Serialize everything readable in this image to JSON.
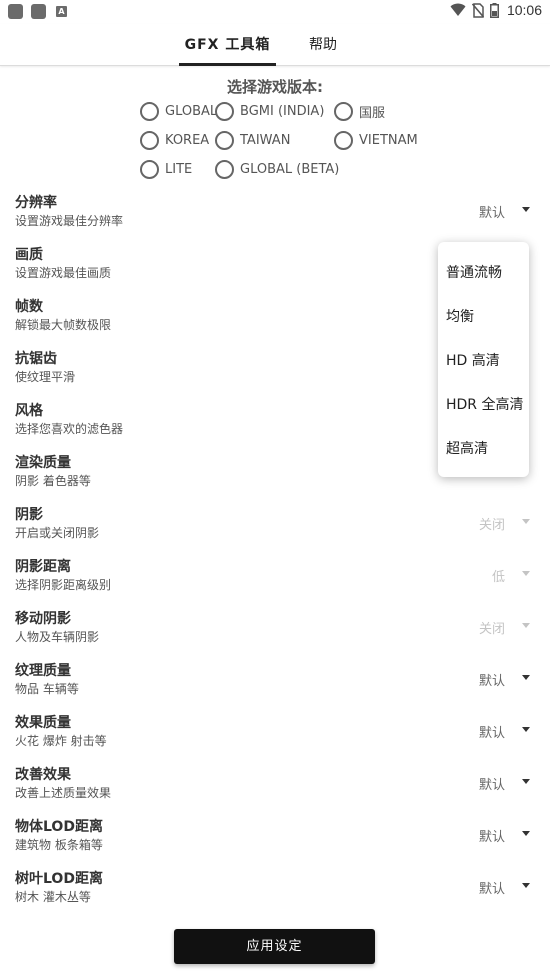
{
  "status_bar": {
    "time": "10:06",
    "left_icons": [
      "app-icon",
      "app-icon",
      "notification-a-icon"
    ],
    "right_icons": [
      "wifi-icon",
      "no-sim-icon",
      "battery-icon"
    ],
    "small_icon_letter": "A"
  },
  "tabs": [
    {
      "label": "GFX 工具箱",
      "active": true
    },
    {
      "label": "帮助",
      "active": false
    }
  ],
  "version": {
    "title": "选择游戏版本:",
    "options": [
      "GLOBAL",
      "BGMI (INDIA)",
      "国服",
      "KOREA",
      "TAIWAN",
      "VIETNAM",
      "LITE",
      "GLOBAL (BETA)"
    ]
  },
  "settings": [
    {
      "title": "分辨率",
      "subtitle": "设置游戏最佳分辨率",
      "value": "默认",
      "faded": false
    },
    {
      "title": "画质",
      "subtitle": "设置游戏最佳画质",
      "value": "",
      "faded": false
    },
    {
      "title": "帧数",
      "subtitle": "解锁最大帧数极限",
      "value": "",
      "faded": false
    },
    {
      "title": "抗锯齿",
      "subtitle": "使纹理平滑",
      "value": "",
      "faded": false
    },
    {
      "title": "风格",
      "subtitle": "选择您喜欢的滤色器",
      "value": "",
      "faded": false
    },
    {
      "title": "渲染质量",
      "subtitle": "阴影 着色器等",
      "value": "",
      "faded": false
    },
    {
      "title": "阴影",
      "subtitle": "开启或关闭阴影",
      "value": "关闭",
      "faded": true
    },
    {
      "title": "阴影距离",
      "subtitle": "选择阴影距离级别",
      "value": "低",
      "faded": true
    },
    {
      "title": "移动阴影",
      "subtitle": "人物及车辆阴影",
      "value": "关闭",
      "faded": true
    },
    {
      "title": "纹理质量",
      "subtitle": "物品 车辆等",
      "value": "默认",
      "faded": false
    },
    {
      "title": "效果质量",
      "subtitle": "火花 爆炸 射击等",
      "value": "默认",
      "faded": false
    },
    {
      "title": "改善效果",
      "subtitle": "改善上述质量效果",
      "value": "默认",
      "faded": false
    },
    {
      "title": "物体LOD距离",
      "subtitle": "建筑物 板条箱等",
      "value": "默认",
      "faded": false
    },
    {
      "title": "树叶LOD距离",
      "subtitle": "树木 灌木丛等",
      "value": "默认",
      "faded": false
    }
  ],
  "dropdown": {
    "items": [
      "普通流畅",
      "均衡",
      "HD 高清",
      "HDR 全高清",
      "超高清"
    ]
  },
  "apply_button": {
    "label": "应用设定"
  }
}
